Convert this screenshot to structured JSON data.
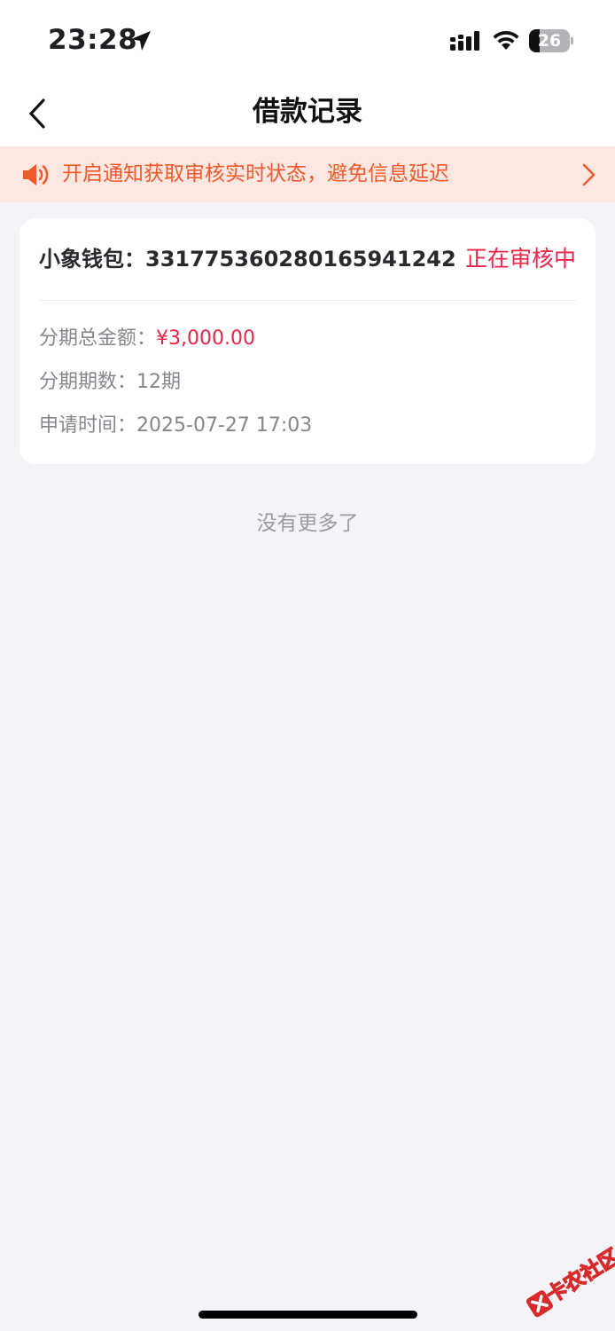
{
  "status_bar": {
    "time": "23:28",
    "battery_level": "26",
    "battery_fraction": 0.26
  },
  "nav": {
    "title": "借款记录"
  },
  "notice": {
    "text": "开启通知获取审核实时状态，避免信息延迟",
    "color": "#f15a2b"
  },
  "record": {
    "title": "小象钱包：331775360280165941242",
    "status": "正在审核中",
    "amount_label": "分期总金额：",
    "amount_value": "¥3,000.00",
    "periods_label": "分期期数：",
    "periods_value": "12期",
    "time_label": "申请时间：",
    "time_value": "2025-07-27 17:03"
  },
  "list_footer": "没有更多了",
  "watermark": {
    "text": "卡农社区"
  },
  "colors": {
    "accent_red": "#e8254b",
    "notice_bg": "#fde7e3",
    "page_bg": "#f3f3f8"
  },
  "icons": [
    "location-arrow-icon",
    "cellular-signal-icon",
    "wifi-icon",
    "battery-icon",
    "chevron-left-icon",
    "speaker-icon",
    "chevron-right-icon"
  ]
}
